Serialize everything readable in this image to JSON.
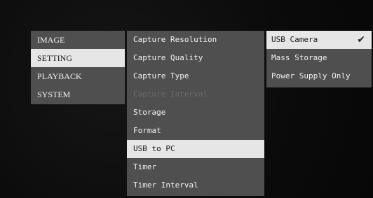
{
  "menu": {
    "main": [
      {
        "label": "IMAGE"
      },
      {
        "label": "SETTING"
      },
      {
        "label": "PLAYBACK"
      },
      {
        "label": "SYSTEM"
      }
    ],
    "main_selected": "SETTING",
    "setting": [
      {
        "label": "Capture Resolution"
      },
      {
        "label": "Capture Quality"
      },
      {
        "label": "Capture Type"
      },
      {
        "label": "Capture Interval",
        "disabled": true
      },
      {
        "label": "Storage"
      },
      {
        "label": "Format"
      },
      {
        "label": "USB to PC"
      },
      {
        "label": "Timer"
      },
      {
        "label": "Timer Interval"
      }
    ],
    "setting_selected": "USB to PC",
    "usb_options": [
      {
        "label": "USB Camera",
        "checked": true
      },
      {
        "label": "Mass Storage"
      },
      {
        "label": "Power Supply Only"
      }
    ],
    "check_glyph": "✔",
    "colors": {
      "panel": "#4f4f4f",
      "selected_bg": "#e6e6e6",
      "text": "#f2f2f2",
      "disabled_text": "#6a6a6a"
    }
  }
}
